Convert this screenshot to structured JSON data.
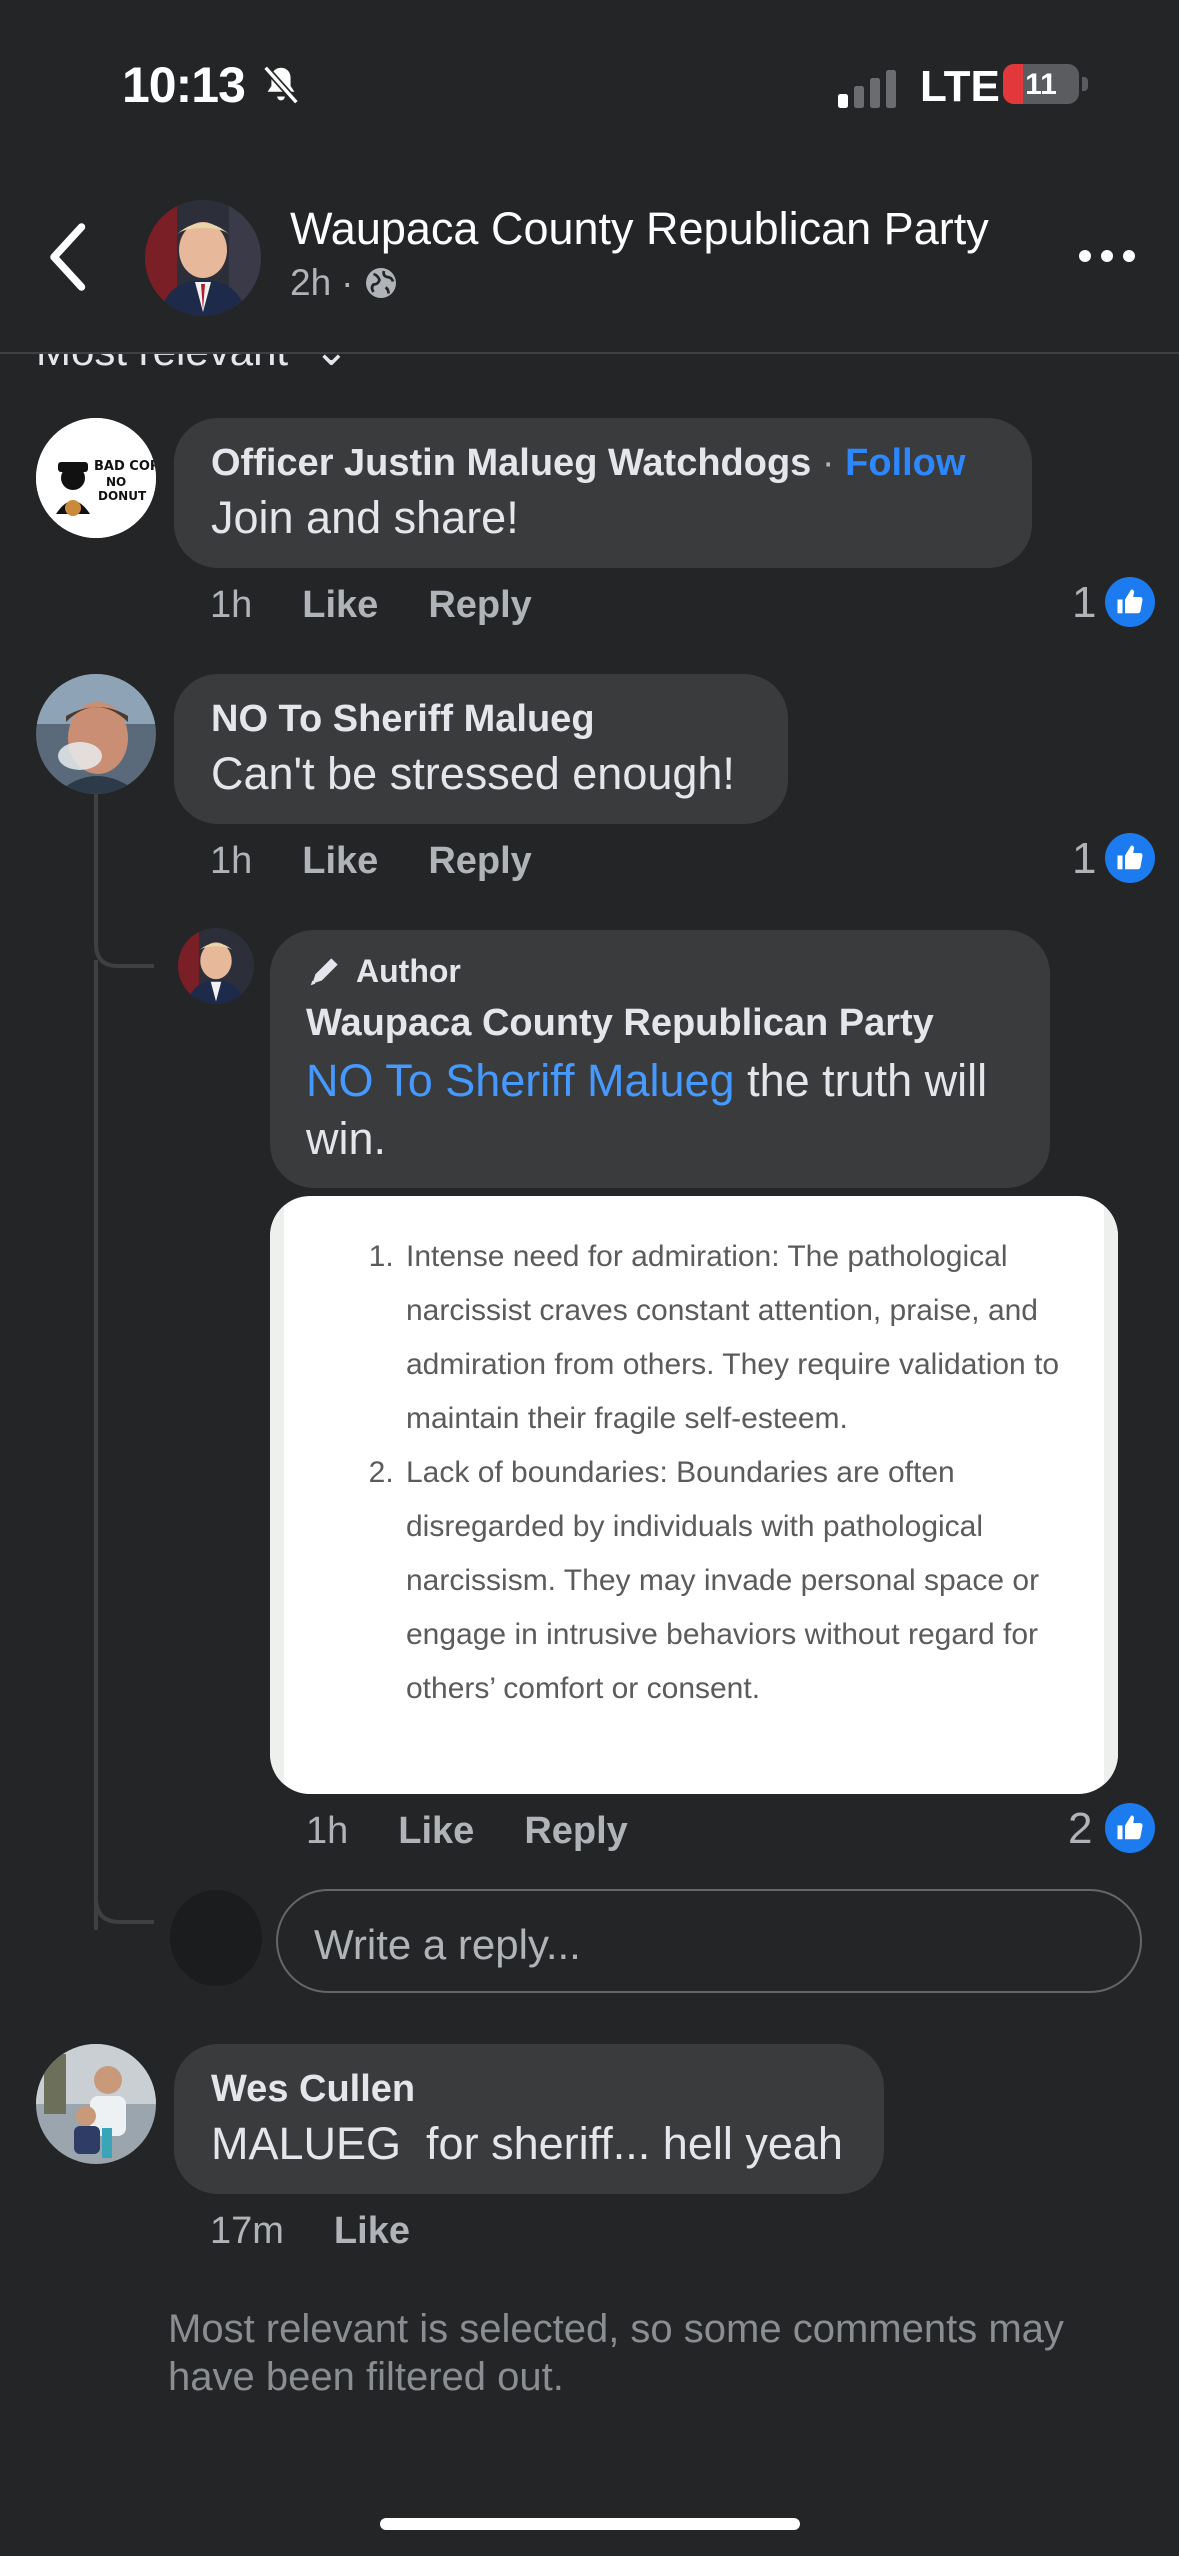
{
  "status_bar": {
    "time": "10:13",
    "network": "LTE",
    "battery": "11"
  },
  "header": {
    "title": "Waupaca County Republican Party",
    "age": "2h",
    "separator": "·",
    "audience_icon": "globe-icon"
  },
  "sort": {
    "label": "Most relevant"
  },
  "comments": [
    {
      "name": "Officer Justin Malueg Watchdogs",
      "follow_separator": "·",
      "follow": "Follow",
      "text": "Join and share!",
      "time": "1h",
      "like": "Like",
      "reply": "Reply",
      "reactions": "1",
      "avatar_text": "BAD COP NO DONUT"
    },
    {
      "name": "NO To Sheriff Malueg",
      "text": "Can't be stressed enough!",
      "time": "1h",
      "like": "Like",
      "reply": "Reply",
      "reactions": "1"
    },
    {
      "author_badge": "Author",
      "name": "Waupaca County Republican Party",
      "mention": "NO To Sheriff Malueg",
      "text": " the truth will win.",
      "time": "1h",
      "like": "Like",
      "reply": "Reply",
      "reactions": "2",
      "attachment": {
        "items": [
          "Intense need for admiration: The pathological narcissist craves constant attention, praise, and admiration from others. They require validation to maintain their fragile self-esteem.",
          "Lack of boundaries: Boundaries are often disregarded by individuals with pathological narcissism. They may invade personal space or engage in intrusive behaviors without regard for others’ comfort or consent."
        ]
      }
    },
    {
      "name": "Wes Cullen",
      "text": "MALUEG  for sheriff... hell yeah",
      "time": "17m",
      "like": "Like"
    }
  ],
  "reply_input": {
    "placeholder": "Write a reply..."
  },
  "footer_note": "Most relevant is selected, so some comments may have been filtered out.",
  "colors": {
    "background": "#242526",
    "bubble": "#3a3b3c",
    "link": "#4599ff",
    "like_blue": "#1d7bf0"
  }
}
